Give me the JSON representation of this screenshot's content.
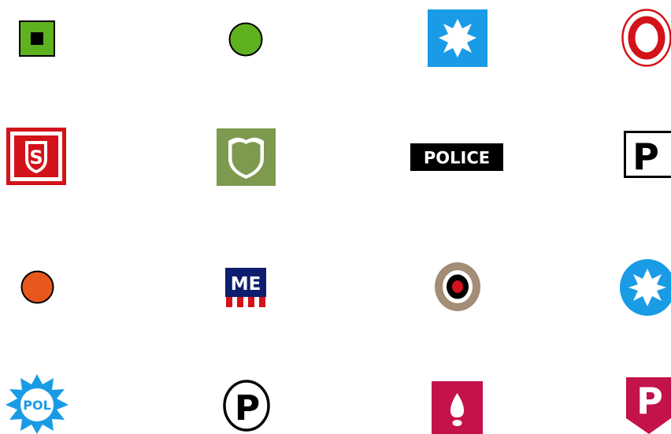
{
  "colors": {
    "green": "#5fb21f",
    "blue": "#1a9be6",
    "red": "#d3121a",
    "olive": "#7d9a4f",
    "orange": "#e8581c",
    "navy": "#0c1e6d",
    "bullseye_outer": "#a38d77",
    "crimson": "#c4124a",
    "black": "#000000",
    "white": "#ffffff"
  },
  "icons": [
    {
      "name": "green-square-icon"
    },
    {
      "name": "green-circle-icon"
    },
    {
      "name": "blue-star-square-icon"
    },
    {
      "name": "red-ring-icon"
    },
    {
      "name": "red-s-shield-icon"
    },
    {
      "name": "green-shield-icon"
    },
    {
      "name": "police-label-icon",
      "text": "POLICE"
    },
    {
      "name": "parking-square-icon",
      "text": "P"
    },
    {
      "name": "orange-circle-icon"
    },
    {
      "name": "me-flag-icon",
      "text": "ME"
    },
    {
      "name": "bullseye-icon"
    },
    {
      "name": "blue-star-circle-icon"
    },
    {
      "name": "pol-star-icon",
      "text": "POL"
    },
    {
      "name": "parking-circle-icon",
      "text": "P"
    },
    {
      "name": "crimson-drop-icon"
    },
    {
      "name": "crimson-p-pennant-icon",
      "text": "P"
    }
  ]
}
